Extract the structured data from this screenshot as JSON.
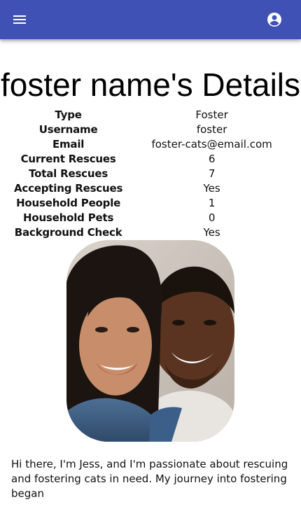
{
  "header": {
    "menu_icon": "menu-icon",
    "account_icon": "account-circle-icon",
    "bar_color": "#3f51b5"
  },
  "page": {
    "title": "foster name's Details"
  },
  "details": {
    "rows": [
      {
        "label": "Type",
        "value": "Foster"
      },
      {
        "label": "Username",
        "value": "foster"
      },
      {
        "label": "Email",
        "value": "foster-cats@email.com"
      },
      {
        "label": "Current Rescues",
        "value": "6"
      },
      {
        "label": "Total Rescues",
        "value": "7"
      },
      {
        "label": "Accepting Rescues",
        "value": "Yes"
      },
      {
        "label": "Household People",
        "value": "1"
      },
      {
        "label": "Household Pets",
        "value": "0"
      },
      {
        "label": "Background Check",
        "value": "Yes"
      }
    ]
  },
  "bio": {
    "text": "Hi there, I'm Jess, and I'm passionate about rescuing and fostering cats in need. My journey into fostering began"
  }
}
